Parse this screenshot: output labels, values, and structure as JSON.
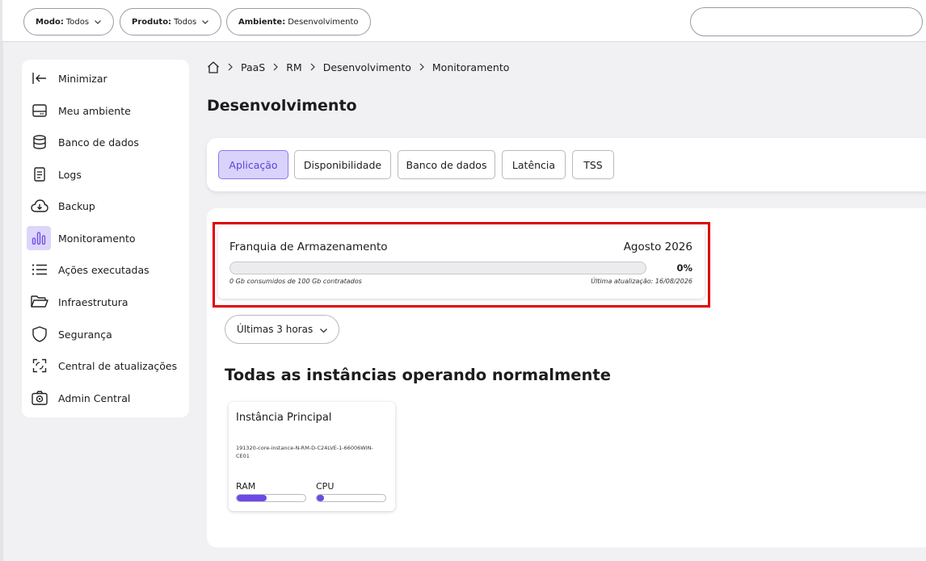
{
  "filters": [
    {
      "key": "Modo:",
      "value": "Todos",
      "has_chevron": true
    },
    {
      "key": "Produto:",
      "value": "Todos",
      "has_chevron": true
    },
    {
      "key": "Ambiente:",
      "value": "Desenvolvimento",
      "has_chevron": false
    }
  ],
  "search": {
    "placeholder": ""
  },
  "sidebar": {
    "items": [
      {
        "label": "Minimizar",
        "icon": "collapse-left-icon"
      },
      {
        "label": "Meu ambiente",
        "icon": "server-icon"
      },
      {
        "label": "Banco de dados",
        "icon": "database-icon"
      },
      {
        "label": "Logs",
        "icon": "document-icon"
      },
      {
        "label": "Backup",
        "icon": "cloud-download-icon"
      },
      {
        "label": "Monitoramento",
        "icon": "bar-chart-icon",
        "active": true
      },
      {
        "label": "Ações executadas",
        "icon": "list-icon"
      },
      {
        "label": "Infraestrutura",
        "icon": "folder-icon"
      },
      {
        "label": "Segurança",
        "icon": "shield-icon"
      },
      {
        "label": "Central de atualizações",
        "icon": "refresh-icon"
      },
      {
        "label": "Admin Central",
        "icon": "camera-settings-icon"
      }
    ]
  },
  "breadcrumb": [
    "PaaS",
    "RM",
    "Desenvolvimento",
    "Monitoramento"
  ],
  "page_title": "Desenvolvimento",
  "tabs": [
    {
      "label": "Aplicação",
      "active": true
    },
    {
      "label": "Disponibilidade"
    },
    {
      "label": "Banco de dados"
    },
    {
      "label": "Latência"
    },
    {
      "label": "TSS"
    }
  ],
  "storage": {
    "title": "Franquia de Armazenamento",
    "month": "Agosto 2026",
    "percent_label": "0%",
    "percent_value": 0,
    "used_text": "0 Gb consumidos de 100 Gb contratados",
    "updated_text": "Última atualização: 16/08/2026"
  },
  "time_range": {
    "value": "Últimas 3 horas"
  },
  "status_heading": "Todas as instâncias operando normalmente",
  "instance": {
    "title": "Instância Principal",
    "id": "191320-core-instance-N-RM-D-C24LVE-1-66006WIN-CE01",
    "ram_label": "RAM",
    "ram_fraction": 0.43,
    "cpu_label": "CPU",
    "cpu_fraction": 0.1
  },
  "colors": {
    "accent": "#6d4ae8",
    "active_tab_bg": "#d9d3fb",
    "highlight": "#e00000"
  }
}
